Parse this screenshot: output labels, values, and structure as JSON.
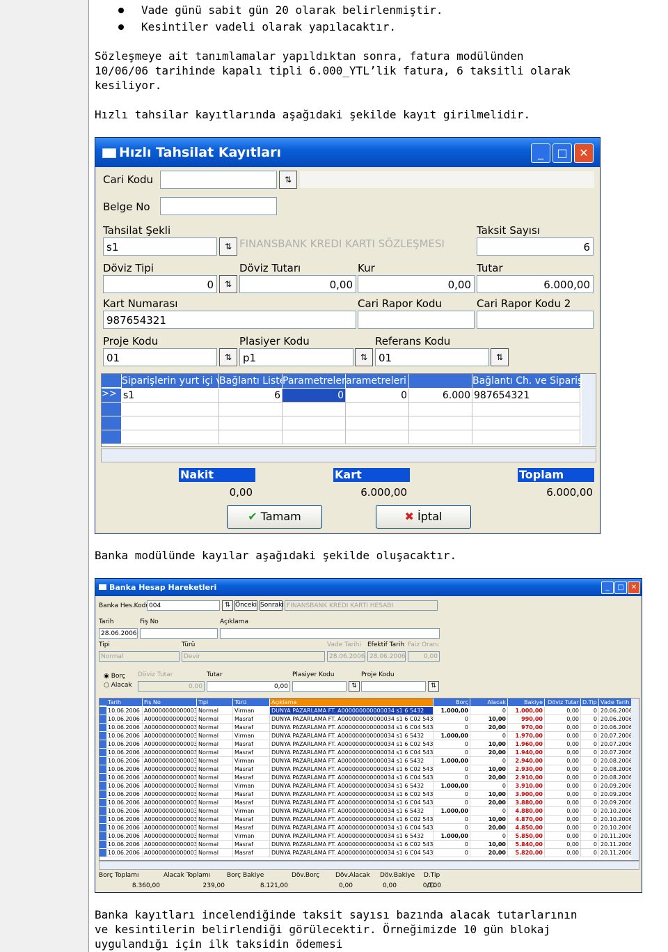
{
  "intro": {
    "bullets": [
      "Vade günü sabit gün 20 olarak belirlenmiştir.",
      "Kesintiler vadeli olarak yapılacaktır."
    ],
    "para1_lines": [
      "Sözleşmeye ait tanımlamalar yapıldıktan sonra, fatura modülünden",
      "10/06/06 tarihinde kapalı tipli 6.000_YTL’lik fatura, 6 taksitli olarak",
      "kesiliyor."
    ],
    "para2": "Hızlı tahsilar kayıtlarında aşağıdaki şekilde kayıt girilmelidir."
  },
  "win1": {
    "title": "Hızlı Tahsilat Kayıtları",
    "labels": {
      "cari_kodu": "Cari Kodu",
      "belge_no": "Belge No",
      "tahsilat_sekli": "Tahsilat Şekli",
      "taksit_sayisi": "Taksit Sayısı",
      "doviz_tipi": "Döviz Tipi",
      "doviz_tutari": "Döviz Tutarı",
      "kur": "Kur",
      "tutar": "Tutar",
      "kart_numarasi": "Kart Numarası",
      "cari_rapor_kodu": "Cari Rapor Kodu",
      "cari_rapor_kodu2": "Cari Rapor Kodu 2",
      "proje_kodu": "Proje Kodu",
      "plasiyer_kodu": "Plasiyer Kodu",
      "referans_kodu": "Referans Kodu"
    },
    "values": {
      "cari_kodu": "",
      "belge_no": "",
      "tahsilat_sekli": "s1",
      "tahsilat_desc": "FINANSBANK KREDI KARTI SÖZLEŞMESI",
      "taksit_sayisi": "6",
      "doviz_tipi": "0",
      "doviz_tutari": "0,00",
      "kur": "0,00",
      "tutar": "6.000,00",
      "kart_numarasi": "987654321",
      "cari_rapor_kodu": "",
      "cari_rapor_kodu2": "",
      "proje_kodu": "01",
      "plasiyer_kodu": "p1",
      "referans_kodu": "01"
    },
    "grid": {
      "headers": [
        "Siparişlerin yurt içi ve",
        "Bağlantı Listesi",
        "Parametreleri",
        "arametreleri",
        "",
        "Bağlantı Ch. ve Sipariş"
      ],
      "row": [
        "s1",
        "6",
        "0",
        "0",
        "6.000",
        "987654321"
      ],
      "row_marker": ">>"
    },
    "totals": {
      "nakit_label": "Nakit",
      "kart_label": "Kart",
      "toplam_label": "Toplam",
      "nakit": "0,00",
      "kart": "6.000,00",
      "toplam": "6.000,00"
    },
    "buttons": {
      "ok": "Tamam",
      "cancel": "İptal"
    }
  },
  "para3": "Banka modülünde kayılar aşağıdaki şekilde oluşacaktır.",
  "win2": {
    "title": "Banka Hesap Hareketleri",
    "banka_hes_kodu_label": "Banka Hes.Kodu",
    "banka_hes_kodu": "004",
    "onceki": "Önceki",
    "sonraki": "Sonraki",
    "hesap_adi": "FINANSBANK KREDI KARTI HESABI",
    "tarih_label": "Tarih",
    "tarih": "28.06.2006",
    "fis_no_label": "Fiş No",
    "fis_no": "",
    "aciklama_label": "Açıklama",
    "aciklama": "",
    "tipi_label": "Tipi",
    "tipi": "Normal",
    "turu_label": "Türü",
    "turu": "Devir",
    "vade_tarihi_label": "Vade Tarihi",
    "vade_tarihi": "28.06.2006",
    "efektif_tarih_label": "Efektif Tarih",
    "efektif_tarih": "28.06.2006",
    "faiz_orani_label": "Faiz Oranı",
    "faiz_orani": "0,00",
    "borc_label": "Borç",
    "alacak_label": "Alacak",
    "doviz_tutar_label": "Döviz Tutar",
    "doviz_tutar": "0,00",
    "tutar_label": "Tutar",
    "tutar": "0,00",
    "plasiyer_kodu_label": "Plasiyer Kodu",
    "proje_kodu_label": "Proje Kodu",
    "headers": [
      "Tarih",
      "Fiş No",
      "Tipi",
      "Türü",
      "Açıklama",
      "Borç",
      "Alacak",
      "Bakiye",
      "Döviz Tutar",
      "D.Tip",
      "Vade Tarih"
    ],
    "rows": [
      [
        "10.06.2006",
        "A000000000000034",
        "Normal",
        "Virman",
        "DUNYA PAZARLAMA FT. A000000000000034 s1 6 5432",
        "1.000,00",
        "0",
        "0",
        "1.000,00",
        "0,00",
        "0",
        "20.06.2006"
      ],
      [
        "10.06.2006",
        "A000000000000034",
        "Normal",
        "Masraf",
        "DUNYA PAZARLAMA FT. A000000000000034 s1 6 C02 5432",
        "0",
        "10,00",
        "0",
        "990,00",
        "0,00",
        "0",
        "20.06.2006"
      ],
      [
        "10.06.2006",
        "A000000000000034",
        "Normal",
        "Masraf",
        "DUNYA PAZARLAMA FT. A000000000000034 s1 6 C04 5432",
        "0",
        "20,00",
        "0",
        "970,00",
        "0,00",
        "0",
        "20.06.2006"
      ],
      [
        "10.06.2006",
        "A000000000000034",
        "Normal",
        "Virman",
        "DUNYA PAZARLAMA FT. A000000000000034 s1 6 5432",
        "1.000,00",
        "0",
        "0",
        "1.970,00",
        "0,00",
        "0",
        "20.07.2006"
      ],
      [
        "10.06.2006",
        "A000000000000034",
        "Normal",
        "Masraf",
        "DUNYA PAZARLAMA FT. A000000000000034 s1 6 C02 5432",
        "0",
        "10,00",
        "0",
        "1.960,00",
        "0,00",
        "0",
        "20.07.2006"
      ],
      [
        "10.06.2006",
        "A000000000000034",
        "Normal",
        "Masraf",
        "DUNYA PAZARLAMA FT. A000000000000034 s1 6 C04 5432",
        "0",
        "20,00",
        "0",
        "1.940,00",
        "0,00",
        "0",
        "20.07.2006"
      ],
      [
        "10.06.2006",
        "A000000000000034",
        "Normal",
        "Virman",
        "DUNYA PAZARLAMA FT. A000000000000034 s1 6 5432",
        "1.000,00",
        "0",
        "0",
        "2.940,00",
        "0,00",
        "0",
        "20.08.2006"
      ],
      [
        "10.06.2006",
        "A000000000000034",
        "Normal",
        "Masraf",
        "DUNYA PAZARLAMA FT. A000000000000034 s1 6 C02 5432",
        "0",
        "10,00",
        "0",
        "2.930,00",
        "0,00",
        "0",
        "20.08.2006"
      ],
      [
        "10.06.2006",
        "A000000000000034",
        "Normal",
        "Masraf",
        "DUNYA PAZARLAMA FT. A000000000000034 s1 6 C04 5432",
        "0",
        "20,00",
        "0",
        "2.910,00",
        "0,00",
        "0",
        "20.08.2006"
      ],
      [
        "10.06.2006",
        "A000000000000034",
        "Normal",
        "Virman",
        "DUNYA PAZARLAMA FT. A000000000000034 s1 6 5432",
        "1.000,00",
        "0",
        "0",
        "3.910,00",
        "0,00",
        "0",
        "20.09.2006"
      ],
      [
        "10.06.2006",
        "A000000000000034",
        "Normal",
        "Masraf",
        "DUNYA PAZARLAMA FT. A000000000000034 s1 6 C02 5432",
        "0",
        "10,00",
        "0",
        "3.900,00",
        "0,00",
        "0",
        "20.09.2006"
      ],
      [
        "10.06.2006",
        "A000000000000034",
        "Normal",
        "Masraf",
        "DUNYA PAZARLAMA FT. A000000000000034 s1 6 C04 5432",
        "0",
        "20,00",
        "0",
        "3.880,00",
        "0,00",
        "0",
        "20.09.2006"
      ],
      [
        "10.06.2006",
        "A000000000000034",
        "Normal",
        "Virman",
        "DUNYA PAZARLAMA FT. A000000000000034 s1 6 5432",
        "1.000,00",
        "0",
        "0",
        "4.880,00",
        "0,00",
        "0",
        "20.10.2006"
      ],
      [
        "10.06.2006",
        "A000000000000034",
        "Normal",
        "Masraf",
        "DUNYA PAZARLAMA FT. A000000000000034 s1 6 C02 5432",
        "0",
        "10,00",
        "0",
        "4.870,00",
        "0,00",
        "0",
        "20.10.2006"
      ],
      [
        "10.06.2006",
        "A000000000000034",
        "Normal",
        "Masraf",
        "DUNYA PAZARLAMA FT. A000000000000034 s1 6 C04 5432",
        "0",
        "20,00",
        "0",
        "4.850,00",
        "0,00",
        "0",
        "20.10.2006"
      ],
      [
        "10.06.2006",
        "A000000000000034",
        "Normal",
        "Virman",
        "DUNYA PAZARLAMA FT. A000000000000034 s1 6 5432",
        "1.000,00",
        "0",
        "0",
        "5.850,00",
        "0,00",
        "0",
        "20.11.2006"
      ],
      [
        "10.06.2006",
        "A000000000000034",
        "Normal",
        "Masraf",
        "DUNYA PAZARLAMA FT. A000000000000034 s1 6 C02 5432",
        "0",
        "10,00",
        "0",
        "5.840,00",
        "0,00",
        "0",
        "20.11.2006"
      ],
      [
        "10.06.2006",
        "A000000000000034",
        "Normal",
        "Masraf",
        "DUNYA PAZARLAMA FT. A000000000000034 s1 6 C04 5432",
        "0",
        "20,00",
        "0",
        "5.820,00",
        "0,00",
        "0",
        "20.11.2006"
      ]
    ],
    "footer_labels": [
      "Borç Toplamı",
      "Alacak Toplamı",
      "Borç Bakiye",
      "Döv.Borç",
      "Döv.Alacak",
      "Döv.Bakiye",
      "D.Tip"
    ],
    "footer_values": [
      "8.360,00",
      "239,00",
      "8.121,00",
      "0,00",
      "0,00",
      "0,00",
      "0/TL"
    ]
  },
  "para4_lines": [
    "Banka kayıtları incelendiğinde taksit sayısı bazında alacak tutarlarının",
    "ve kesintilerin belirlendiği görülecektir. Örneğimizde 10 gün blokaj",
    "uygulandığı için ilk taksidin ödemesi"
  ]
}
